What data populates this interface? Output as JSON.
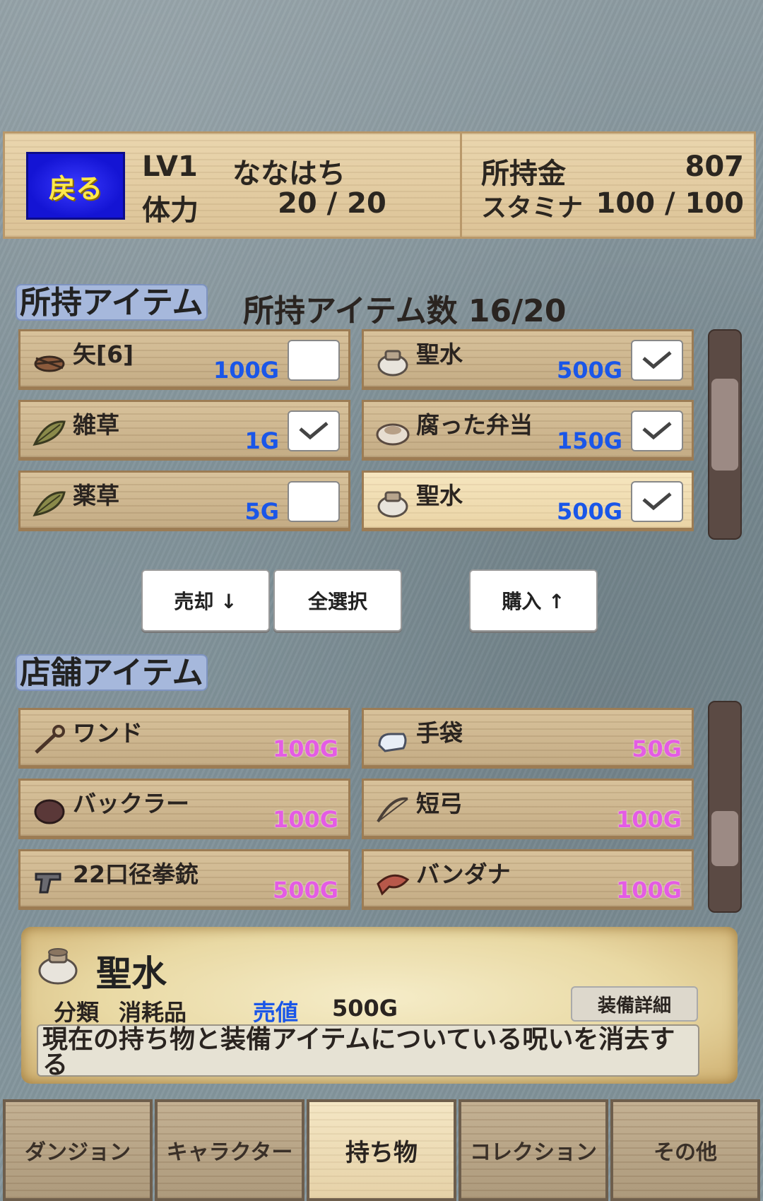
{
  "header": {
    "back_label": "戻る",
    "level": "LV1",
    "player_name": "ななはち",
    "hp_label": "体力",
    "hp_value": "20 / 20",
    "gold_label": "所持金",
    "gold_value": "807",
    "stamina_label": "スタミナ",
    "stamina_value": "100 / 100"
  },
  "owned": {
    "section_label": "所持アイテム",
    "count_text": "所持アイテム数 16/20",
    "items": [
      {
        "name": "矢[6]",
        "price": "100G",
        "icon": "arrow-bundle-icon",
        "checked": false
      },
      {
        "name": "聖水",
        "price": "500G",
        "icon": "jar-icon",
        "checked": true
      },
      {
        "name": "雑草",
        "price": "1G",
        "icon": "leaf-icon",
        "checked": true
      },
      {
        "name": "腐った弁当",
        "price": "150G",
        "icon": "rotten-lunch-icon",
        "checked": true
      },
      {
        "name": "薬草",
        "price": "5G",
        "icon": "leaf-icon",
        "checked": false
      },
      {
        "name": "聖水",
        "price": "500G",
        "icon": "jar-icon",
        "checked": true,
        "selected": true
      }
    ]
  },
  "actions": {
    "sell": "売却 ↓",
    "select_all": "全選択",
    "buy": "購入 ↑"
  },
  "shop": {
    "section_label": "店舗アイテム",
    "items": [
      {
        "name": "ワンド",
        "price": "100G",
        "icon": "wand-icon"
      },
      {
        "name": "手袋",
        "price": "50G",
        "icon": "glove-icon"
      },
      {
        "name": "バックラー",
        "price": "100G",
        "icon": "buckler-icon"
      },
      {
        "name": "短弓",
        "price": "100G",
        "icon": "bow-icon"
      },
      {
        "name": "22口径拳銃",
        "price": "500G",
        "icon": "pistol-icon"
      },
      {
        "name": "バンダナ",
        "price": "100G",
        "icon": "bandana-icon"
      }
    ]
  },
  "detail": {
    "name": "聖水",
    "category_label": "分類",
    "category_value": "消耗品",
    "sell_label": "売値",
    "sell_value": "500G",
    "equip_button": "装備詳細",
    "description": "現在の持ち物と装備アイテムについている呪いを消去する"
  },
  "nav": [
    {
      "label": "ダンジョン",
      "active": false
    },
    {
      "label": "キャラクター",
      "active": false
    },
    {
      "label": "持ち物",
      "active": true
    },
    {
      "label": "コレクション",
      "active": false
    },
    {
      "label": "その他",
      "active": false
    }
  ],
  "colors": {
    "price_owned": "#1a56e8",
    "price_shop": "#e45ce4",
    "sell_label": "#1a56e8",
    "back_button": "#1c1ce0"
  }
}
